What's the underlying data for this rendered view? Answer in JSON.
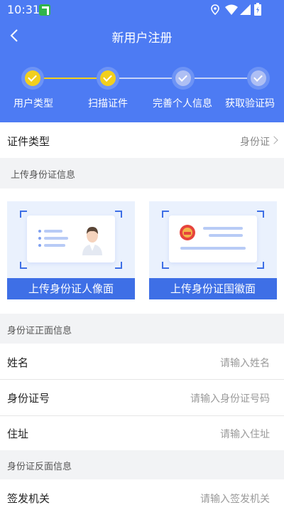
{
  "status": {
    "time": "10:31"
  },
  "header": {
    "title": "新用户注册"
  },
  "steps": [
    {
      "label": "用户类型",
      "state": "done"
    },
    {
      "label": "扫描证件",
      "state": "done"
    },
    {
      "label": "完善个人信息",
      "state": "pending"
    },
    {
      "label": "获取验证码",
      "state": "pending"
    }
  ],
  "id_type": {
    "label": "证件类型",
    "value": "身份证"
  },
  "sections": {
    "upload": "上传身份证信息",
    "front": "身份证正面信息",
    "back": "身份证反面信息"
  },
  "upload": {
    "portrait_label": "上传身份证人像面",
    "emblem_label": "上传身份证国徽面"
  },
  "fields": {
    "name": {
      "label": "姓名",
      "placeholder": "请输入姓名"
    },
    "id_number": {
      "label": "身份证号",
      "placeholder": "请输入身份证号码"
    },
    "address": {
      "label": "住址",
      "placeholder": "请输入住址"
    },
    "authority": {
      "label": "签发机关",
      "placeholder": "请输入签发机关"
    }
  },
  "colors": {
    "primary": "#4d7bf3",
    "step_done": "#f2cf1d",
    "step_pending": "#aebff4",
    "card_label": "#3e6fe6"
  }
}
